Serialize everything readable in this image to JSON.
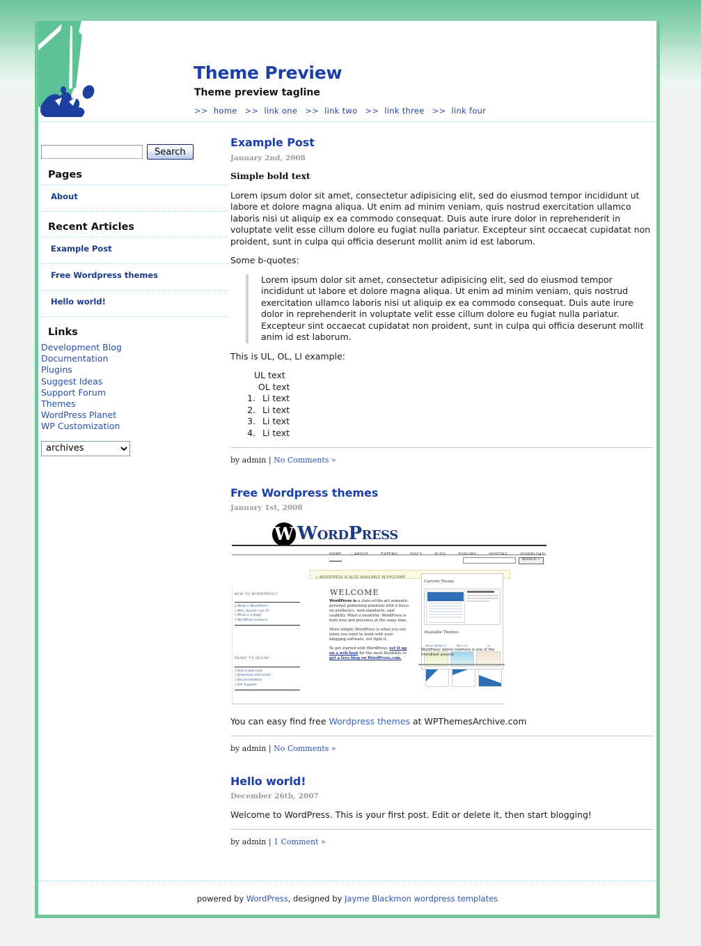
{
  "site": {
    "title": "Theme Preview",
    "tagline": "Theme preview tagline",
    "nav_sep": ">>",
    "nav": [
      {
        "label": "home"
      },
      {
        "label": "link one"
      },
      {
        "label": "link two"
      },
      {
        "label": "link three"
      },
      {
        "label": "link four"
      }
    ]
  },
  "sidebar": {
    "search": {
      "value": "",
      "placeholder": "",
      "button_label": "Search"
    },
    "pages": {
      "title": "Pages",
      "items": [
        {
          "label": "About"
        }
      ]
    },
    "recent": {
      "title": "Recent Articles",
      "items": [
        {
          "label": "Example Post"
        },
        {
          "label": "Free Wordpress themes"
        },
        {
          "label": "Hello world!"
        }
      ]
    },
    "links": {
      "title": "Links",
      "items": [
        {
          "label": "Development Blog"
        },
        {
          "label": "Documentation"
        },
        {
          "label": "Plugins"
        },
        {
          "label": "Suggest Ideas"
        },
        {
          "label": "Support Forum"
        },
        {
          "label": "Themes"
        },
        {
          "label": "WordPress Planet"
        },
        {
          "label": "WP Customization"
        }
      ]
    },
    "archives": {
      "selected": "archives",
      "options": [
        "archives"
      ]
    }
  },
  "posts": [
    {
      "title": "Example Post",
      "date": "January 2nd, 2008",
      "bold_line": "Simple bold text",
      "body": "Lorem ipsum dolor sit amet, consectetur adipisicing elit, sed do eiusmod tempor incididunt ut labore et dolore magna aliqua. Ut enim ad minim veniam, quis nostrud exercitation ullamco laboris nisi ut aliquip ex ea commodo consequat. Duis aute irure dolor in reprehenderit in voluptate velit esse cillum dolore eu fugiat nulla pariatur. Excepteur sint occaecat cupidatat non proident, sunt in culpa qui officia deserunt mollit anim id est laborum.",
      "bquote_intro": "Some b-quotes:",
      "blockquote": "Lorem ipsum dolor sit amet, consectetur adipisicing elit, sed do eiusmod tempor incididunt ut labore et dolore magna aliqua. Ut enim ad minim veniam, quis nostrud exercitation ullamco laboris nisi ut aliquip ex ea commodo consequat. Duis aute irure dolor in reprehenderit in voluptate velit esse cillum dolore eu fugiat nulla pariatur. Excepteur sint occaecat cupidatat non proident, sunt in culpa qui officia deserunt mollit anim id est laborum.",
      "list_intro": "This is UL, OL, LI example:",
      "ul_text": "UL text",
      "ol_text": "OL text",
      "li_items": [
        "Li text",
        "Li text",
        "Li text",
        "Li text"
      ],
      "meta_author": "by admin |",
      "meta_comments": "No Comments »"
    },
    {
      "title": "Free Wordpress themes",
      "date": "January 1st, 2008",
      "caption_pre": "You can easy find free ",
      "caption_link": "Wordpress themes",
      "caption_post": " at WPThemesArchive.com",
      "meta_author": "by admin |",
      "meta_comments": "No Comments »"
    },
    {
      "title": "Hello world!",
      "date": "December 26th, 2007",
      "body": "Welcome to WordPress. This is your first post. Edit or delete it, then start blogging!",
      "meta_author": "by admin |",
      "meta_comments": "1 Comment »"
    }
  ],
  "wp_screenshot": {
    "mark": "W",
    "wordmark": "WordPress",
    "nav": [
      "HOME",
      "ABOUT",
      "EXTEND",
      "DOCS",
      "BLOG",
      "FORUMS",
      "HOSTING",
      "DOWNLOAD"
    ],
    "search_button": "SEARCH »",
    "notice": "◊ WORDPRESS IS ALSO AVAILABLE IN РУССКИЙ.",
    "welcome": "WELCOME",
    "new_heading": "NEW TO WORDPRESS?",
    "new_items": [
      "◊ What is WordPress?",
      "◊ Why should I use it?",
      "◊ What is a blog?",
      "◊ WordPress Lessons"
    ],
    "ready_heading": "READY TO BEGIN?",
    "ready_items": [
      "◊ Find a web host",
      "◊ Download and Install",
      "◊ Documentation",
      "◊ Get Support"
    ],
    "para1_bold": "WordPress is",
    "para1": " a state-of-the-art semantic personal publishing platform with a focus on aesthetics, web standards, and usability. What a mouthful. WordPress is both free and priceless at the same time.",
    "para2": "More simply, WordPress is what you use when you want to work with your blogging software, not fight it.",
    "para3_pre": "To get started with WordPress, ",
    "para3_link1": "set it up on a web host",
    "para3_mid": " for the most flexibility or ",
    "para3_link2": "get a free blog on WordPress.com.",
    "panel_title": "Current Theme",
    "panel_theme_name": "WordPress Default 1.5 by Michael Heilemann",
    "panel_theme_desc": "The default WordPress theme based on the famous",
    "available_title": "Available Themes",
    "theme_cards": [
      "Almost Spring 1.1",
      "Blix 1.0.3",
      "Co"
    ],
    "admin_caption": "WordPress' admin interface is one of the friendliest around."
  },
  "footer": {
    "pre": "powered by ",
    "wordpress": "WordPress",
    "mid": ", designed by ",
    "designer": "Jayme Blackmon wordpress templates"
  },
  "colors": {
    "accent_green": "#6ec69b",
    "link_blue": "#1a3faa",
    "date_gray": "#9d9d9d"
  }
}
